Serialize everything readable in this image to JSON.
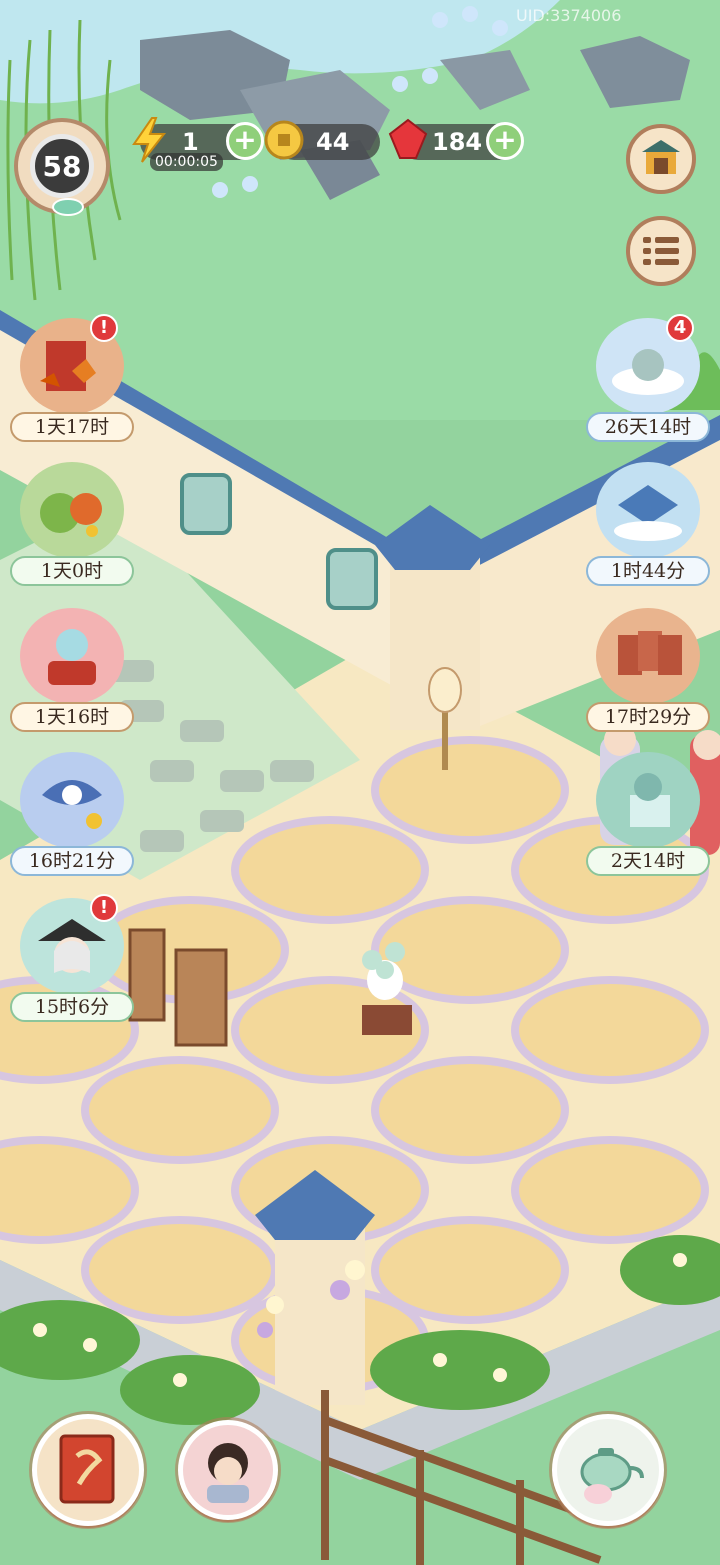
{
  "uid": "UID:3374006",
  "player": {
    "level": "58"
  },
  "resources": {
    "energy": {
      "value": "1",
      "timer": "00:00:05",
      "icon": "lightning-icon"
    },
    "coins": {
      "value": "44",
      "icon": "coin-icon"
    },
    "gems": {
      "value": "184",
      "icon": "red-gem-icon"
    }
  },
  "right_buttons": [
    {
      "name": "shop-pavilion-icon"
    },
    {
      "name": "menu-list-icon"
    }
  ],
  "left_events": [
    {
      "timer": "1天17时",
      "icon": "autumn-book-icon",
      "alert": "!"
    },
    {
      "timer": "1天0时",
      "icon": "vegetable-basket-icon",
      "alert": ""
    },
    {
      "timer": "1天16时",
      "icon": "cat-drum-icon",
      "alert": ""
    },
    {
      "timer": "16时21分",
      "icon": "kite-icon",
      "alert": ""
    },
    {
      "timer": "15时6分",
      "icon": "hat-character-icon",
      "alert": "!"
    }
  ],
  "right_events": [
    {
      "timer": "26天14时",
      "icon": "cat-cloud-icon",
      "badge": "4"
    },
    {
      "timer": "1时44分",
      "icon": "snow-palace-icon",
      "badge": ""
    },
    {
      "timer": "17时29分",
      "icon": "playing-cards-icon",
      "badge": ""
    },
    {
      "timer": "2天14时",
      "icon": "gift-box-icon",
      "badge": ""
    }
  ],
  "bottom_buttons": [
    {
      "name": "recipe-book-icon"
    },
    {
      "name": "character-portrait-icon"
    },
    {
      "name": "teapot-icon"
    }
  ]
}
